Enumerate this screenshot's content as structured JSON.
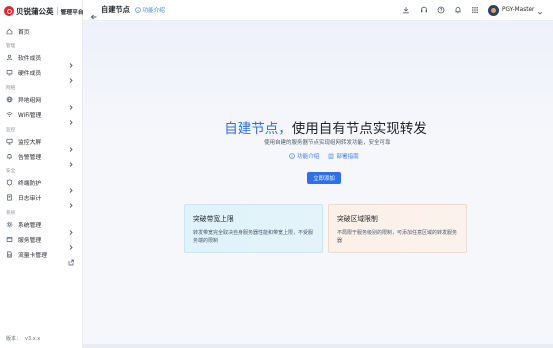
{
  "brand": {
    "name": "贝锐蒲公英",
    "subtitle": "管理平台"
  },
  "sidebar": {
    "home": "首页",
    "sections": [
      {
        "label": "管理"
      },
      {
        "label": "网络"
      },
      {
        "label": "监控"
      },
      {
        "label": "安全"
      },
      {
        "label": "系统"
      }
    ],
    "items": [
      {
        "label": "软件成员",
        "icon": "user-icon"
      },
      {
        "label": "硬件成员",
        "icon": "device-icon"
      },
      {
        "label": "异地组网",
        "icon": "globe-icon"
      },
      {
        "label": "WiFi管理",
        "icon": "wifi-icon"
      },
      {
        "label": "监控大屏",
        "icon": "monitor-icon"
      },
      {
        "label": "告警管理",
        "icon": "bell-icon"
      },
      {
        "label": "终端防护",
        "icon": "shield-icon"
      },
      {
        "label": "日志审计",
        "icon": "document-icon"
      },
      {
        "label": "系统管理",
        "icon": "settings-icon"
      },
      {
        "label": "服务管理",
        "icon": "service-icon"
      },
      {
        "label": "流量卡管理",
        "icon": "sim-card-icon"
      }
    ],
    "version_label": "版本：",
    "version_value": "v3.x.x"
  },
  "header": {
    "title": "自建节点",
    "intro_link": "功能介绍",
    "user_name": "PGY-Master"
  },
  "hero": {
    "title_highlight": "自建节点，",
    "title_rest": "使用自有节点实现转发",
    "subtitle": "使用自建的服务器节点实现组网转发功能，安全可靠",
    "link_intro": "功能介绍",
    "link_deploy": "部署指南",
    "cta": "立即添加"
  },
  "cards": [
    {
      "title": "突破带宽上限",
      "desc": "转发带宽完全取决自身服务器性能和带宽上限，不受服务端的限制",
      "color": "#e0f3fb"
    },
    {
      "title": "突破区域限制",
      "desc": "不局限于服务级别的限制，可添加任意区域的转发服务器",
      "color": "#fdf0e8"
    }
  ],
  "colors": {
    "accent": "#2f6fec",
    "brand_red": "#e1262d"
  }
}
